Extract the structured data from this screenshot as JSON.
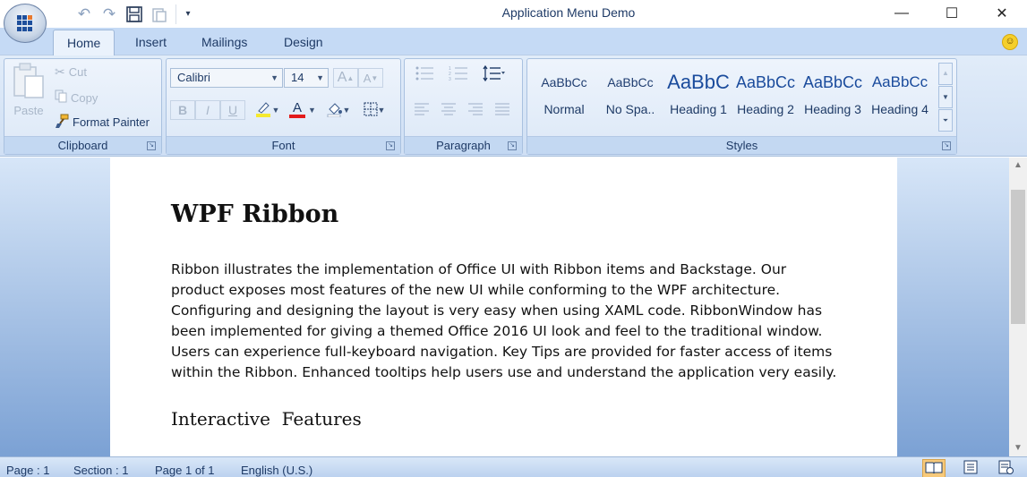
{
  "window": {
    "title": "Application Menu Demo",
    "minimize": "—",
    "maximize": "☐",
    "close": "✕"
  },
  "quick_access": {
    "undo": "↶",
    "redo": "↷",
    "save": "💾",
    "paste": "📋",
    "customize": "▾"
  },
  "tabs": [
    {
      "label": "Home",
      "active": true
    },
    {
      "label": "Insert",
      "active": false
    },
    {
      "label": "Mailings",
      "active": false
    },
    {
      "label": "Design",
      "active": false
    }
  ],
  "clipboard": {
    "caption": "Clipboard",
    "paste": "Paste",
    "cut": "Cut",
    "copy": "Copy",
    "format_painter": "Format Painter"
  },
  "font": {
    "caption": "Font",
    "family": "Calibri",
    "size": "14",
    "grow": "A",
    "shrink": "A",
    "bold": "B",
    "italic": "I",
    "underline": "U",
    "font_color": "A",
    "highlight_color": "#f5e92e",
    "text_color": "#e31b1b"
  },
  "paragraph": {
    "caption": "Paragraph"
  },
  "styles": {
    "caption": "Styles",
    "items": [
      {
        "preview": "AaBbCc",
        "name": "Normal"
      },
      {
        "preview": "AaBbCc",
        "name": "No Spa.."
      },
      {
        "preview": "AaBbC",
        "name": "Heading 1"
      },
      {
        "preview": "AaBbCc",
        "name": "Heading 2"
      },
      {
        "preview": "AaBbCc",
        "name": "Heading 3"
      },
      {
        "preview": "AaBbCc",
        "name": "Heading 4"
      }
    ]
  },
  "document": {
    "heading": "WPF Ribbon",
    "body": "Ribbon illustrates the implementation of Office UI with Ribbon items and Backstage. Our product exposes most features of the new UI while conforming to the WPF architecture. Configuring and designing the layout is very easy when using XAML code. RibbonWindow has been implemented for giving a themed Office 2016 UI look and feel to the traditional window. Users can experience full-keyboard navigation. Key Tips are provided for faster access of items within the Ribbon. Enhanced tooltips help users use and understand the application very easily.",
    "subheading": "Interactive  Features"
  },
  "status": {
    "page": "Page : 1",
    "section": "Section : 1",
    "page_of": "Page 1 of 1",
    "language": "English (U.S.)"
  }
}
